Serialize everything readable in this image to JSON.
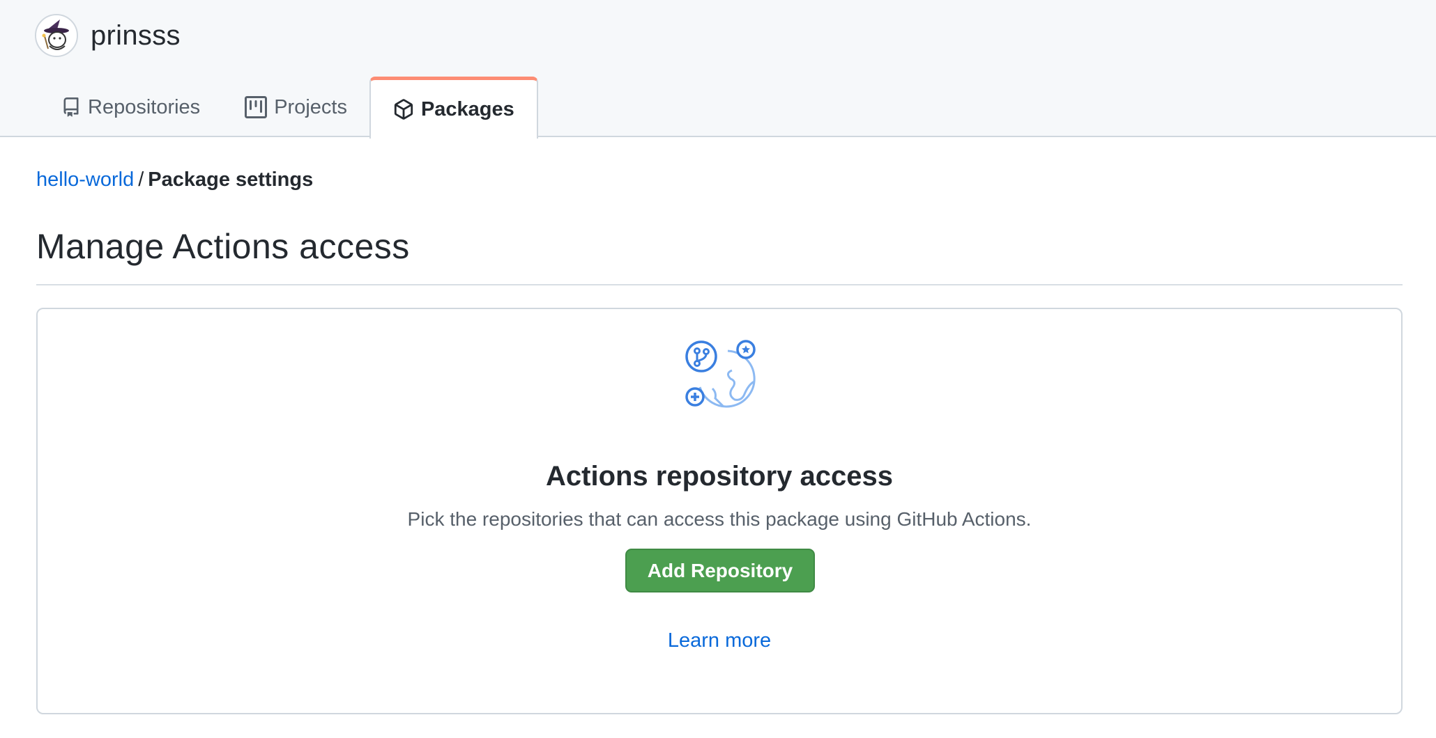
{
  "owner": {
    "name": "prinsss",
    "avatar_icon": "witch-avatar-icon"
  },
  "tabs": [
    {
      "label": "Repositories",
      "icon": "repo-icon",
      "selected": false
    },
    {
      "label": "Projects",
      "icon": "project-icon",
      "selected": false
    },
    {
      "label": "Packages",
      "icon": "package-icon",
      "selected": true
    }
  ],
  "breadcrumb": {
    "link": "hello-world",
    "separator": "/",
    "current": "Package settings"
  },
  "page_title": "Manage Actions access",
  "blankslate": {
    "icon": "globe-repo-icon",
    "title": "Actions repository access",
    "description": "Pick the repositories that can access this package using GitHub Actions.",
    "button_label": "Add Repository",
    "link_label": "Learn more"
  },
  "colors": {
    "accent_tab": "#fd8c73",
    "link": "#0969da",
    "primary_button": "#4c9f50",
    "header_bg": "#f6f8fa"
  }
}
